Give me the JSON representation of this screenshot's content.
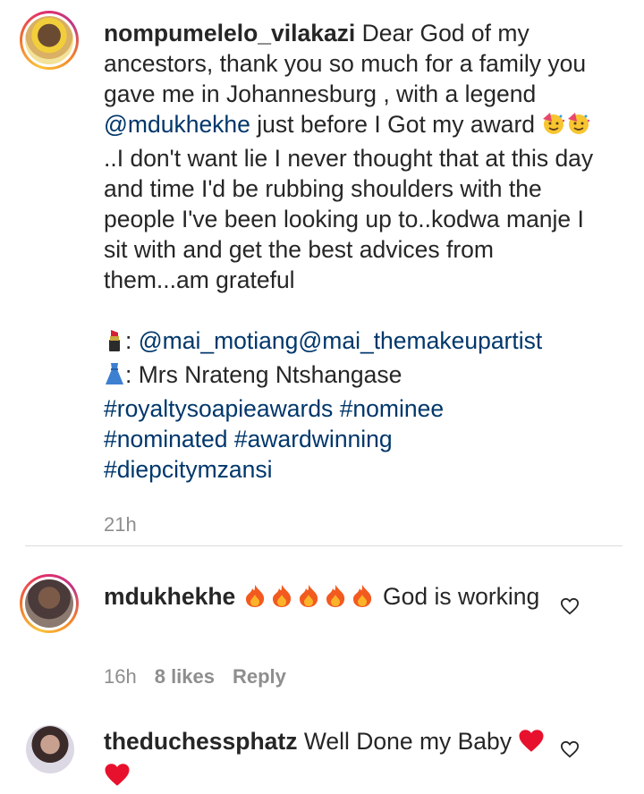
{
  "post": {
    "username": "nompumelelo_vilakazi",
    "caption_line1": " Dear God of my ancestors, thank you so much for a family you gave me in Johannesburg , with a legend ",
    "mention_legend": "@mdukhekhe",
    "caption_line2": " just before I Got my award ",
    "caption_line3": "..I don't want lie I never thought that at this day and time I'd be rubbing shoulders with the people I've been looking up to..kodwa manje I sit with and get the best advices from them...am grateful",
    "credit_makeup_label": ": ",
    "mention_makeup1": "@mai_motiang",
    "mention_makeup2": "@mai_themakeupartist",
    "credit_dress": ": Mrs Nrateng Ntshangase",
    "hashtags": [
      "#royaltysoapieawards",
      "#nominee",
      "#nominated",
      "#awardwinning",
      "#diepcitymzansi"
    ],
    "time": "21h"
  },
  "comments": [
    {
      "username": "mdukhekhe",
      "text_after_emoji": "God is working",
      "time": "16h",
      "likes": "8 likes",
      "reply": "Reply"
    },
    {
      "username": "theduchessphatz",
      "text": " Well Done my Baby "
    }
  ],
  "icons": [
    "party-face-emoji",
    "fire-emoji",
    "red-heart-emoji",
    "lipstick-emoji",
    "dress-emoji",
    "heart-outline-icon"
  ],
  "colors": {
    "link": "#00376b",
    "meta": "#8e8e8e",
    "text": "#262626"
  }
}
